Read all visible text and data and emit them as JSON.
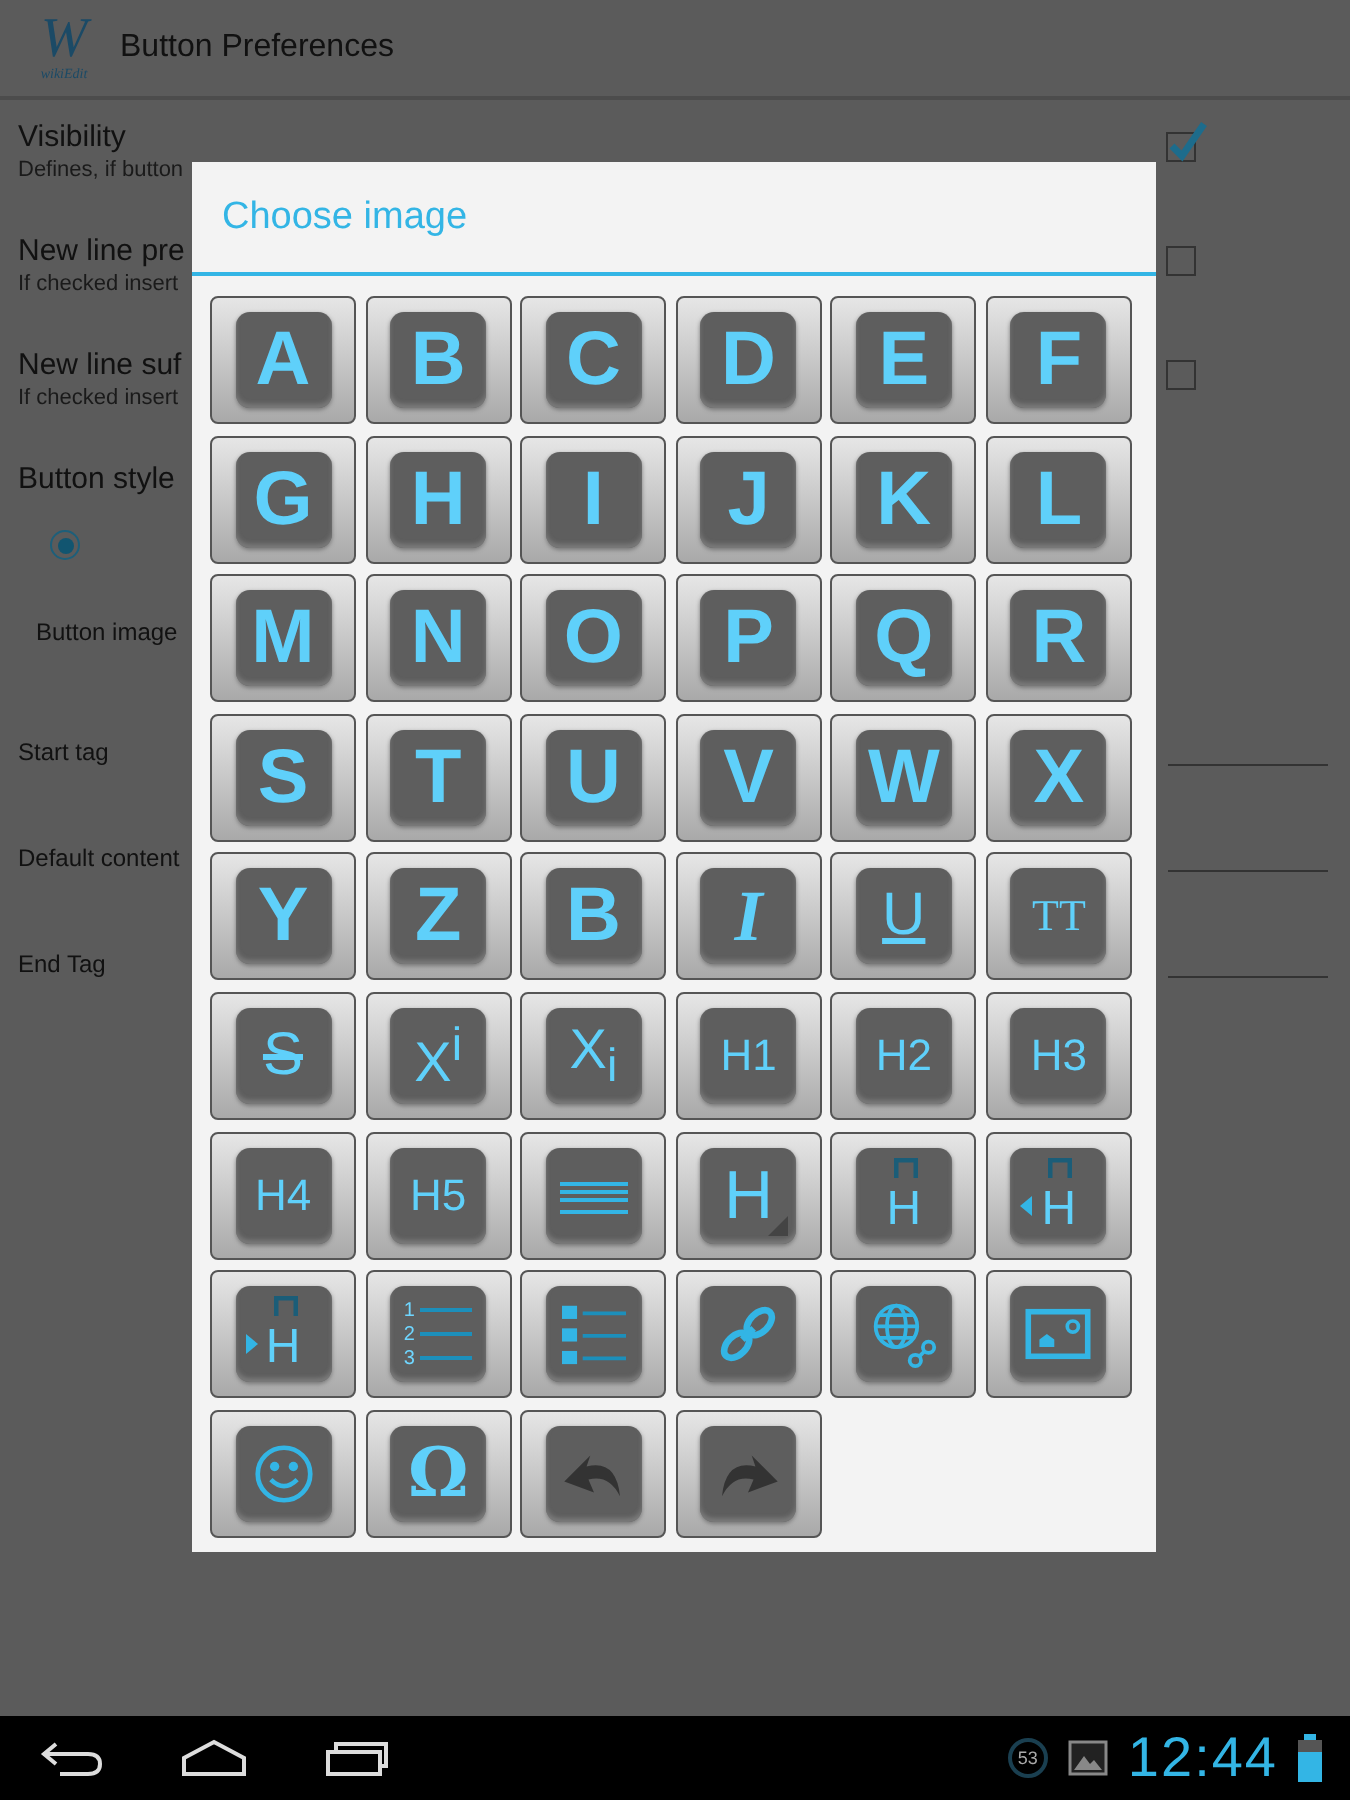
{
  "app_bar": {
    "logo_letter": "W",
    "logo_caption": "wikiEdit",
    "title": "Button Preferences"
  },
  "preferences": [
    {
      "kind": "checkbox",
      "title": "Visibility",
      "summary": "Defines, if button",
      "checked": true
    },
    {
      "kind": "checkbox",
      "title": "New line pre",
      "summary": "If checked insert",
      "checked": false
    },
    {
      "kind": "checkbox",
      "title": "New line suf",
      "summary": "If checked insert",
      "checked": false
    },
    {
      "kind": "category",
      "title": "Button style"
    },
    {
      "kind": "radio",
      "selected": true
    },
    {
      "kind": "label",
      "title": "Button image"
    },
    {
      "kind": "field",
      "title": "Start tag"
    },
    {
      "kind": "field",
      "title": "Default content"
    },
    {
      "kind": "field",
      "title": "End Tag"
    }
  ],
  "dialog": {
    "title": "Choose image",
    "tiles": [
      {
        "kind": "letter",
        "glyph": "A"
      },
      {
        "kind": "letter",
        "glyph": "B"
      },
      {
        "kind": "letter",
        "glyph": "C"
      },
      {
        "kind": "letter",
        "glyph": "D"
      },
      {
        "kind": "letter",
        "glyph": "E"
      },
      {
        "kind": "letter",
        "glyph": "F"
      },
      {
        "kind": "letter",
        "glyph": "G"
      },
      {
        "kind": "letter",
        "glyph": "H"
      },
      {
        "kind": "letter",
        "glyph": "I"
      },
      {
        "kind": "letter",
        "glyph": "J"
      },
      {
        "kind": "letter",
        "glyph": "K"
      },
      {
        "kind": "letter",
        "glyph": "L"
      },
      {
        "kind": "letter",
        "glyph": "M"
      },
      {
        "kind": "letter",
        "glyph": "N"
      },
      {
        "kind": "letter",
        "glyph": "O"
      },
      {
        "kind": "letter",
        "glyph": "P"
      },
      {
        "kind": "letter",
        "glyph": "Q"
      },
      {
        "kind": "letter",
        "glyph": "R"
      },
      {
        "kind": "letter",
        "glyph": "S"
      },
      {
        "kind": "letter",
        "glyph": "T"
      },
      {
        "kind": "letter",
        "glyph": "U"
      },
      {
        "kind": "letter",
        "glyph": "V"
      },
      {
        "kind": "letter",
        "glyph": "W"
      },
      {
        "kind": "letter",
        "glyph": "X"
      },
      {
        "kind": "letter",
        "glyph": "Y"
      },
      {
        "kind": "letter",
        "glyph": "Z"
      },
      {
        "kind": "bold",
        "glyph": "B"
      },
      {
        "kind": "italic",
        "glyph": "I"
      },
      {
        "kind": "underline",
        "glyph": "U"
      },
      {
        "kind": "mono",
        "glyph": "TT"
      },
      {
        "kind": "strike",
        "glyph": "S"
      },
      {
        "kind": "script",
        "glyph": "X$^{i}$"
      },
      {
        "kind": "script",
        "glyph": "X$_{i}$"
      },
      {
        "kind": "heading",
        "glyph": "H1"
      },
      {
        "kind": "heading",
        "glyph": "H2"
      },
      {
        "kind": "heading",
        "glyph": "H3"
      },
      {
        "kind": "heading",
        "glyph": "H4"
      },
      {
        "kind": "heading",
        "glyph": "H5"
      },
      {
        "kind": "paragraph"
      },
      {
        "kind": "h-corner",
        "glyph": "H"
      },
      {
        "kind": "h-bracket",
        "glyph": "H"
      },
      {
        "kind": "h-bracket-left",
        "glyph": "H"
      },
      {
        "kind": "h-bracket-right",
        "glyph": "H"
      },
      {
        "kind": "numbered-list",
        "digits": [
          "1",
          "2",
          "3"
        ]
      },
      {
        "kind": "bullet-list"
      },
      {
        "kind": "link"
      },
      {
        "kind": "globe-link"
      },
      {
        "kind": "image"
      },
      {
        "kind": "smiley"
      },
      {
        "kind": "omega",
        "glyph": "Ω"
      },
      {
        "kind": "undo"
      },
      {
        "kind": "redo"
      }
    ]
  },
  "status_bar": {
    "notification_count": "53",
    "time": "12:44"
  }
}
